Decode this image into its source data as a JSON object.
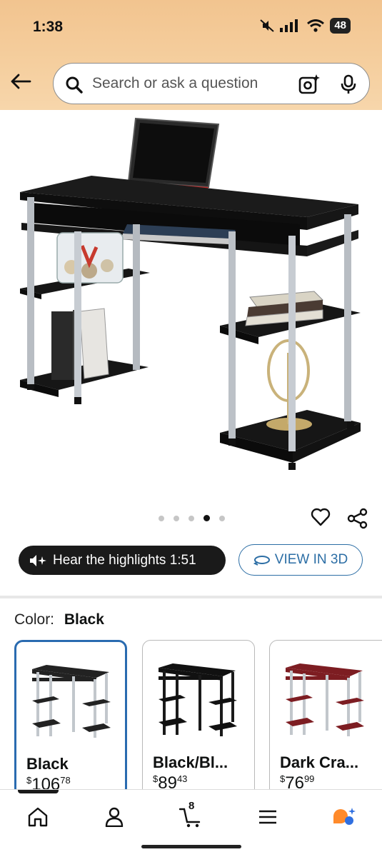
{
  "status_bar": {
    "time": "1:38",
    "battery": "48"
  },
  "search": {
    "placeholder": "Search or ask a question"
  },
  "icons": {
    "back": "back-arrow-icon",
    "search": "search-icon",
    "lens": "camera-lens-icon",
    "mic": "microphone-icon",
    "heart": "heart-icon",
    "share": "share-icon",
    "home": "home-icon",
    "account": "account-icon",
    "cart": "cart-icon",
    "menu": "menu-icon",
    "rufus": "rufus-icon"
  },
  "carousel": {
    "total": 5,
    "active_index": 3
  },
  "hear_button": {
    "label": "Hear the highlights 1:51"
  },
  "view3d_button": {
    "label": "VIEW IN 3D"
  },
  "color": {
    "key": "Color:",
    "value": "Black"
  },
  "swatches": [
    {
      "name": "Black",
      "price_whole": "106",
      "price_fraction": "78",
      "currency": "$",
      "color": "#222222",
      "selected": true
    },
    {
      "name": "Black/Bl...",
      "price_whole": "89",
      "price_fraction": "43",
      "currency": "$",
      "color": "#111111",
      "selected": false
    },
    {
      "name": "Dark Cra...",
      "price_whole": "76",
      "price_fraction": "99",
      "currency": "$",
      "color": "#7d1d22",
      "selected": false
    }
  ],
  "cart": {
    "count": "8"
  },
  "colors": {
    "accent_blue": "#2a6bb0",
    "header_bg": "#f2c48f",
    "rufus_orange": "#ff8a2a",
    "rufus_blue": "#2f6fe0"
  }
}
